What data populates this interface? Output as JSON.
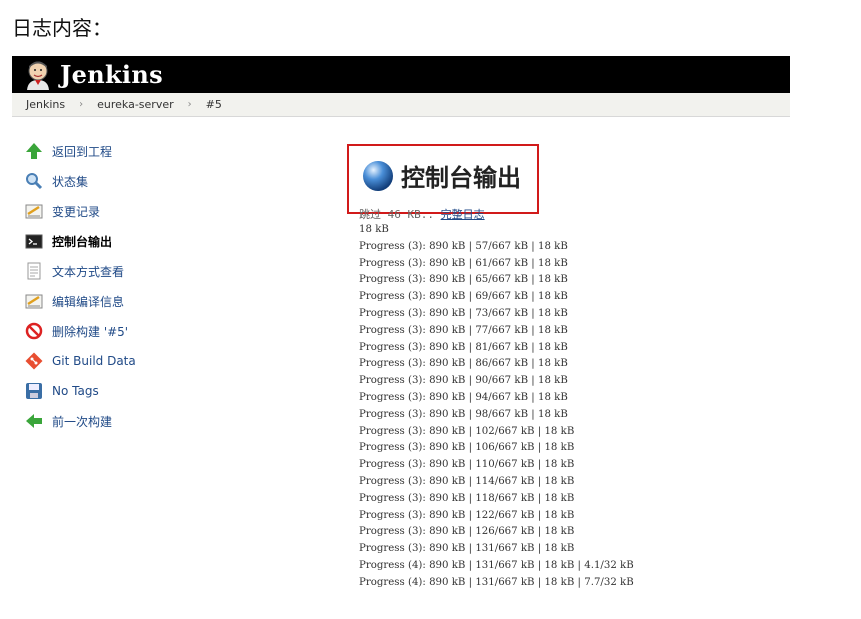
{
  "doc_label": "日志内容：",
  "header": {
    "brand": "Jenkins"
  },
  "breadcrumb": {
    "items": [
      "Jenkins",
      "eureka-server",
      "#5"
    ],
    "separator": "›"
  },
  "sidebar": {
    "items": [
      {
        "label": "返回到工程",
        "icon": "up-arrow-icon"
      },
      {
        "label": "状态集",
        "icon": "search-icon"
      },
      {
        "label": "变更记录",
        "icon": "notepad-icon"
      },
      {
        "label": "控制台输出",
        "icon": "terminal-icon"
      },
      {
        "label": "文本方式查看",
        "icon": "document-icon"
      },
      {
        "label": "编辑编译信息",
        "icon": "notepad-icon"
      },
      {
        "label": "删除构建 '#5'",
        "icon": "no-entry-icon"
      },
      {
        "label": "Git Build Data",
        "icon": "git-icon"
      },
      {
        "label": "No Tags",
        "icon": "save-icon"
      },
      {
        "label": "前一次构建",
        "icon": "left-arrow-icon"
      }
    ]
  },
  "main": {
    "title": "控制台输出",
    "skip_prefix": "跳过 46 KB..",
    "skip_link": "完整日志",
    "console_lines": [
      "18 kB",
      "Progress (3): 890 kB | 57/667 kB | 18 kB",
      "Progress (3): 890 kB | 61/667 kB | 18 kB",
      "Progress (3): 890 kB | 65/667 kB | 18 kB",
      "Progress (3): 890 kB | 69/667 kB | 18 kB",
      "Progress (3): 890 kB | 73/667 kB | 18 kB",
      "Progress (3): 890 kB | 77/667 kB | 18 kB",
      "Progress (3): 890 kB | 81/667 kB | 18 kB",
      "Progress (3): 890 kB | 86/667 kB | 18 kB",
      "Progress (3): 890 kB | 90/667 kB | 18 kB",
      "Progress (3): 890 kB | 94/667 kB | 18 kB",
      "Progress (3): 890 kB | 98/667 kB | 18 kB",
      "Progress (3): 890 kB | 102/667 kB | 18 kB",
      "Progress (3): 890 kB | 106/667 kB | 18 kB",
      "Progress (3): 890 kB | 110/667 kB | 18 kB",
      "Progress (3): 890 kB | 114/667 kB | 18 kB",
      "Progress (3): 890 kB | 118/667 kB | 18 kB",
      "Progress (3): 890 kB | 122/667 kB | 18 kB",
      "Progress (3): 890 kB | 126/667 kB | 18 kB",
      "Progress (3): 890 kB | 131/667 kB | 18 kB",
      "Progress (4): 890 kB | 131/667 kB | 18 kB | 4.1/32 kB",
      "Progress (4): 890 kB | 131/667 kB | 18 kB | 7.7/32 kB"
    ]
  },
  "colors": {
    "highlight_border": "#d11a1a",
    "link": "#204a87",
    "header_bg": "#000000"
  }
}
